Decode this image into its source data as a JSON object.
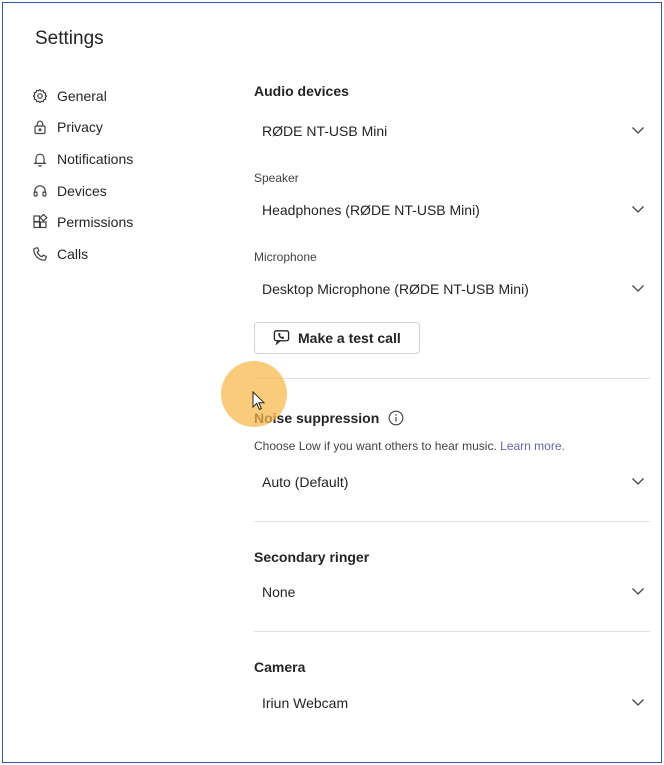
{
  "window": {
    "title": "Settings"
  },
  "sidebar": {
    "items": [
      {
        "label": "General",
        "icon": "gear-icon"
      },
      {
        "label": "Privacy",
        "icon": "lock-icon"
      },
      {
        "label": "Notifications",
        "icon": "bell-icon"
      },
      {
        "label": "Devices",
        "icon": "headset-icon"
      },
      {
        "label": "Permissions",
        "icon": "apps-icon"
      },
      {
        "label": "Calls",
        "icon": "phone-icon"
      }
    ]
  },
  "audio_devices": {
    "title": "Audio devices",
    "device_value": "RØDE NT-USB Mini",
    "speaker_label": "Speaker",
    "speaker_value": "Headphones (RØDE NT-USB Mini)",
    "microphone_label": "Microphone",
    "microphone_value": "Desktop Microphone (RØDE NT-USB Mini)",
    "test_call_label": "Make a test call"
  },
  "noise_suppression": {
    "title": "Noise suppression",
    "hint": "Choose Low if you want others to hear music.",
    "learn_more": "Learn more.",
    "value": "Auto (Default)"
  },
  "secondary_ringer": {
    "title": "Secondary ringer",
    "value": "None"
  },
  "camera": {
    "title": "Camera",
    "value": "Iriun Webcam"
  },
  "colors": {
    "border": "#2f5ea8",
    "link": "#6264a7",
    "cursor_highlight": "#f6b748"
  }
}
